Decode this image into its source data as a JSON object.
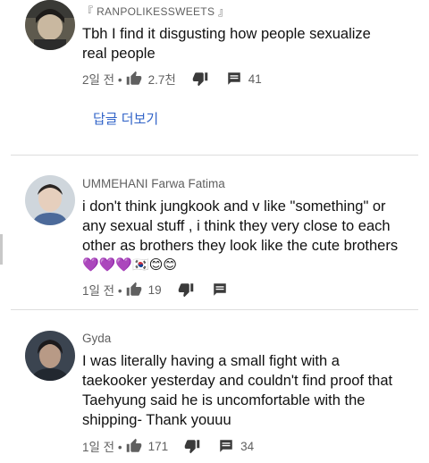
{
  "comments": [
    {
      "author": "RANPOLIKESSWEETS",
      "author_prefix": "『",
      "author_suffix": "』",
      "text_lines": [
        "Tbh I find it disgusting how people sexualize",
        "real people"
      ],
      "time": "2일 전 •",
      "likes": "2.7천",
      "replies": "41"
    },
    {
      "author": "UMMEHANI Farwa Fatima",
      "text_lines": [
        "i don't think jungkook and v like \"something\" or",
        "any sexual stuff , i think they very close to each",
        "other as brothers they look like the cute brothers"
      ],
      "emoji_line": "💜💜💜🇰🇷😊😊",
      "time": "1일 전 •",
      "likes": "19",
      "replies": ""
    },
    {
      "author": "Gyda",
      "text_lines": [
        "I was literally having a small fight with a",
        "taekooker yesterday and couldn't find proof that",
        "Taehyung said he is uncomfortable with the",
        "shipping- Thank youuu"
      ],
      "time": "1일 전 •",
      "likes": "171",
      "replies": "34"
    }
  ],
  "view_replies_label": "답글 더보기",
  "colors": {
    "meta_text": "#606060",
    "link": "#3264c8",
    "divider": "#dddddd"
  },
  "icons": {
    "like": "thumbs-up-icon",
    "dislike": "thumbs-down-icon",
    "reply": "comment-icon"
  }
}
